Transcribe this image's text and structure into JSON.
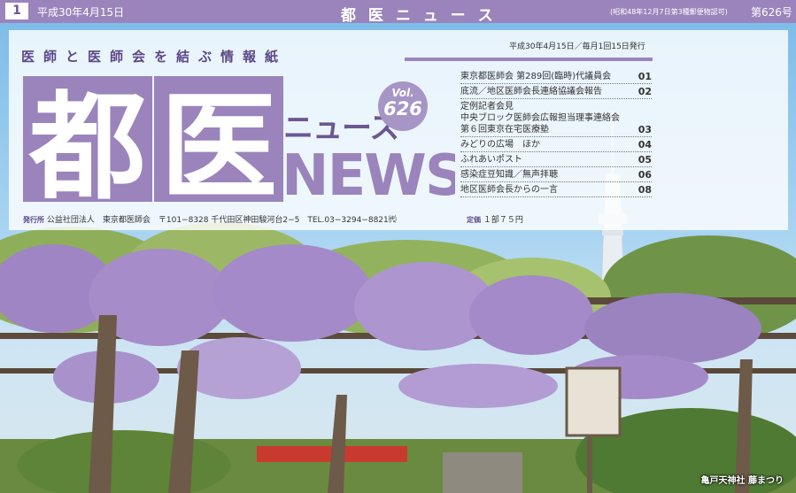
{
  "top_bar": {
    "page_number": "1",
    "date": "平成30年4月15日",
    "title": "都 医 ニ ュ ー ス",
    "mail_note": "(昭和48年12月7日第3種郵便物認可)",
    "issue_number": "第626号"
  },
  "masthead": {
    "tagline": "医師と医師会を結ぶ情報紙",
    "publication_date": "平成30年4月15日／毎月1回15日発行",
    "logo_kanji_1": "都",
    "logo_kanji_2": "医",
    "logo_katakana": "ニュース",
    "logo_news": "NEWS",
    "vol_label": "Vol.",
    "vol_number": "626"
  },
  "contents": [
    {
      "title": "東京都医師会 第289回(臨時)代議員会",
      "page": "01"
    },
    {
      "title": "底流／地区医師会長連絡協議会報告",
      "page": "02"
    },
    {
      "lines": [
        "定例記者会見",
        "中央ブロック医師会広報担当理事連絡会",
        "第６回東京在宅医療塾"
      ],
      "page": "03"
    },
    {
      "title": "みどりの広場　ほか",
      "page": "04"
    },
    {
      "title": "ふれあいポスト",
      "page": "05"
    },
    {
      "title": "感染症豆知識／無声拝聴",
      "page": "06"
    },
    {
      "title": "地区医師会長からの一言",
      "page": "08"
    }
  ],
  "publisher": {
    "label": "発行所",
    "text": "公益社団法人　東京都医師会　〒101−8328 千代田区神田駿河台2−5　TEL.03−3294−8821㈹"
  },
  "price": {
    "label": "定価",
    "text": "１部７５円"
  },
  "photo": {
    "caption": "亀戸天神社 藤まつり"
  },
  "colors": {
    "brand_purple": "#9a84bb",
    "dark_purple": "#5b4787",
    "wisteria": "#a48ac8"
  }
}
